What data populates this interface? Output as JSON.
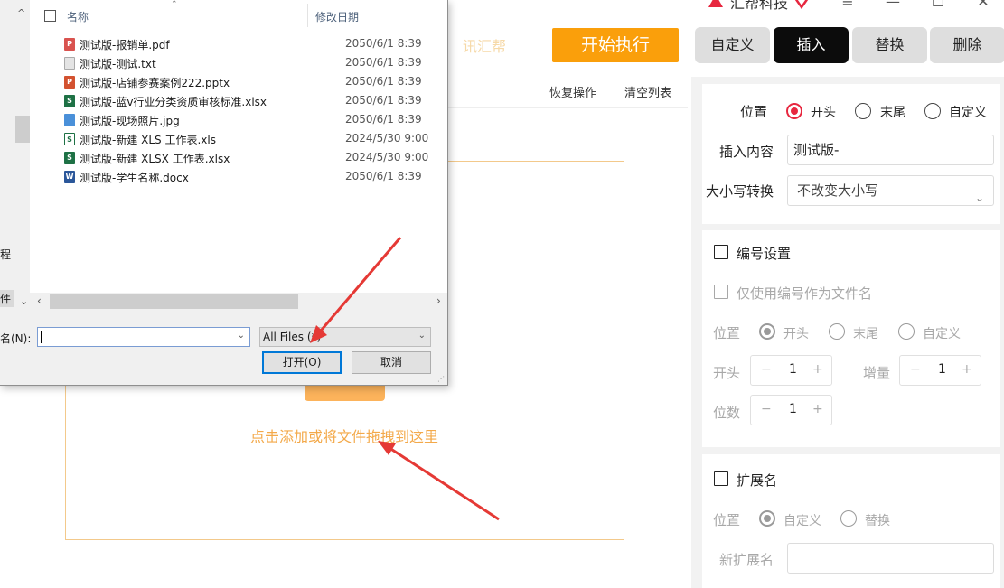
{
  "app": {
    "brand_name": "汇帮科技",
    "window_controls": {
      "menu": "≡",
      "minimize": "—",
      "maximize": "☐",
      "close": "✕"
    },
    "start_button": "开始执行",
    "ghost_text": "讯汇帮",
    "tabs": [
      {
        "label": "自定义",
        "active": false
      },
      {
        "label": "插入",
        "active": true
      },
      {
        "label": "替换",
        "active": false
      },
      {
        "label": "删除",
        "active": false
      }
    ],
    "toolbar": {
      "undo": "恢复操作",
      "clear": "清空列表"
    },
    "dropzone": {
      "hint": "点击添加或将文件拖拽到这里"
    }
  },
  "insert_panel": {
    "position": {
      "label": "位置",
      "options": [
        "开头",
        "末尾",
        "自定义"
      ],
      "selected": "开头"
    },
    "content": {
      "label": "插入内容",
      "value": "测试版-"
    },
    "case": {
      "label": "大小写转换",
      "value": "不改变大小写"
    },
    "numbering": {
      "label": "编号设置",
      "only_number": "仅使用编号作为文件名",
      "position": {
        "label": "位置",
        "options": [
          "开头",
          "末尾",
          "自定义"
        ],
        "selected": "开头"
      },
      "start": {
        "label": "开头",
        "value": "1"
      },
      "increment": {
        "label": "增量",
        "value": "1"
      },
      "digits": {
        "label": "位数",
        "value": "1"
      }
    },
    "extension": {
      "label": "扩展名",
      "position": {
        "label": "位置",
        "options": [
          "自定义",
          "替换"
        ],
        "selected": "自定义"
      },
      "new_ext": {
        "label": "新扩展名",
        "value": ""
      }
    }
  },
  "file_dialog": {
    "nav_items": [
      "程",
      "件"
    ],
    "columns": {
      "name": "名称",
      "date": "修改日期"
    },
    "files": [
      {
        "name": "测试版-报销单.pdf",
        "date": "2050/6/1 8:39",
        "icon": "pdf-icon",
        "color": "#d9534f"
      },
      {
        "name": "测试版-测试.txt",
        "date": "2050/6/1 8:39",
        "icon": "txt-icon",
        "color": "#9e9e9e"
      },
      {
        "name": "测试版-店铺参赛案例222.pptx",
        "date": "2050/6/1 8:39",
        "icon": "pptx-icon",
        "color": "#d35230"
      },
      {
        "name": "测试版-蓝v行业分类资质审核标准.xlsx",
        "date": "2050/6/1 8:39",
        "icon": "xlsx-icon",
        "color": "#1e7145"
      },
      {
        "name": "测试版-现场照片.jpg",
        "date": "2050/6/1 8:39",
        "icon": "jpg-icon",
        "color": "#4a90d9"
      },
      {
        "name": "测试版-新建 XLS 工作表.xls",
        "date": "2024/5/30 9:00",
        "icon": "xls-icon",
        "color": "#1e7145"
      },
      {
        "name": "测试版-新建 XLSX 工作表.xlsx",
        "date": "2024/5/30 9:00",
        "icon": "xlsx-icon",
        "color": "#1e7145"
      },
      {
        "name": "测试版-学生名称.docx",
        "date": "2050/6/1 8:39",
        "icon": "docx-icon",
        "color": "#2b579a"
      }
    ],
    "filename_label": "名(N):",
    "filename_value": "",
    "filter": "All Files (*)",
    "open_button": "打开(O)",
    "cancel_button": "取消"
  },
  "colors": {
    "accent": "#fa9f0b",
    "radio_red": "#e7273f",
    "arrow_red": "#e53935"
  }
}
